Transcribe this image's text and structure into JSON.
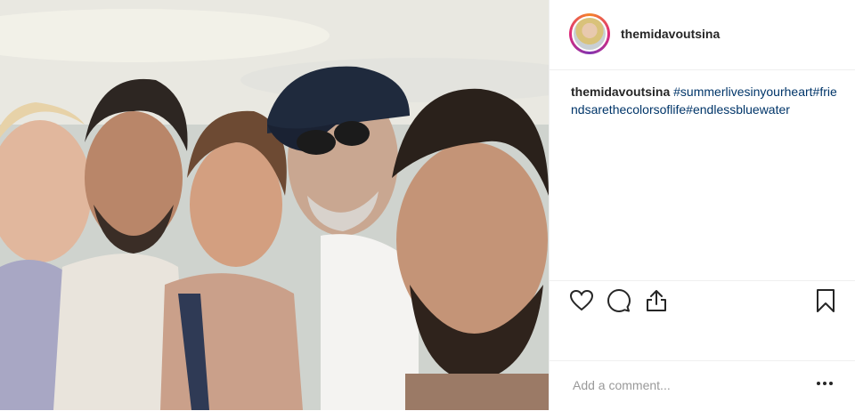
{
  "post": {
    "username": "themidavoutsina",
    "caption": {
      "user": "themidavoutsina",
      "hashtags": "#summerlivesinyourheart#friendsarethecolorsoflife#endlessbluewater"
    },
    "icons": {
      "like": "heart-icon",
      "comment": "comment-icon",
      "share": "share-icon",
      "save": "bookmark-icon",
      "more": "more-options-icon"
    },
    "comment": {
      "placeholder": "Add a comment..."
    }
  }
}
